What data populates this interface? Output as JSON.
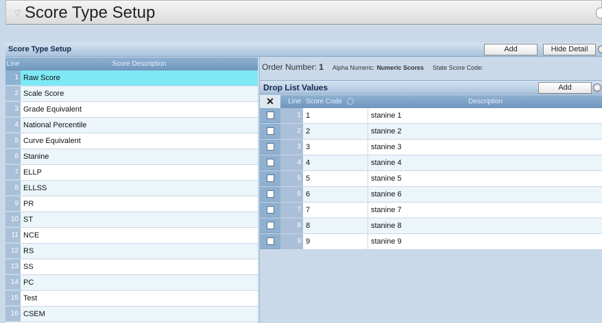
{
  "window": {
    "title": "Score Type Setup"
  },
  "section": {
    "title": "Score Type Setup",
    "add_label": "Add",
    "hide_detail_label": "Hide Detail"
  },
  "score_list": {
    "columns": {
      "line": "Line",
      "description": "Score Description"
    },
    "rows": [
      {
        "line": "1",
        "description": "Raw Score"
      },
      {
        "line": "2",
        "description": "Scale Score"
      },
      {
        "line": "3",
        "description": "Grade Equivalent"
      },
      {
        "line": "4",
        "description": "National Percentile"
      },
      {
        "line": "5",
        "description": "Curve Equivalent"
      },
      {
        "line": "6",
        "description": "Stanine"
      },
      {
        "line": "7",
        "description": "ELLP"
      },
      {
        "line": "8",
        "description": "ELLSS"
      },
      {
        "line": "9",
        "description": "PR"
      },
      {
        "line": "10",
        "description": "ST"
      },
      {
        "line": "11",
        "description": "NCE"
      },
      {
        "line": "12",
        "description": "RS"
      },
      {
        "line": "13",
        "description": "SS"
      },
      {
        "line": "14",
        "description": "PC"
      },
      {
        "line": "15",
        "description": "Test"
      },
      {
        "line": "16",
        "description": "CSEM"
      }
    ],
    "selected_line": "1"
  },
  "detail": {
    "order_number_label": "Order Number:",
    "order_number_value": "1",
    "alpha_numeric_label": "Alpha Numeric:",
    "alpha_numeric_value": "Numeric Scores",
    "state_score_code_label": "State Score Code:",
    "state_score_code_value": ""
  },
  "drop_list": {
    "title": "Drop List Values",
    "add_label": "Add",
    "columns": {
      "select": "✕",
      "line": "Line",
      "score_code": "Score Code",
      "description": "Description"
    },
    "rows": [
      {
        "line": "1",
        "score_code": "1",
        "description": "stanine 1"
      },
      {
        "line": "2",
        "score_code": "2",
        "description": "stanine 2"
      },
      {
        "line": "3",
        "score_code": "3",
        "description": "stanine 3"
      },
      {
        "line": "4",
        "score_code": "4",
        "description": "stanine 4"
      },
      {
        "line": "5",
        "score_code": "5",
        "description": "stanine 5"
      },
      {
        "line": "6",
        "score_code": "6",
        "description": "stanine 6"
      },
      {
        "line": "7",
        "score_code": "7",
        "description": "stanine 7"
      },
      {
        "line": "8",
        "score_code": "8",
        "description": "stanine 8"
      },
      {
        "line": "9",
        "score_code": "9",
        "description": "stanine 9"
      }
    ]
  },
  "colors": {
    "selected_row": "#7ee8f5",
    "header_blue": "#8fb1d1",
    "panel_bg": "#c9d9ea"
  },
  "icons": [
    "collapse-arrow-icon",
    "refresh-icon",
    "sort-icon",
    "delete-x-icon",
    "checkbox-icon"
  ]
}
